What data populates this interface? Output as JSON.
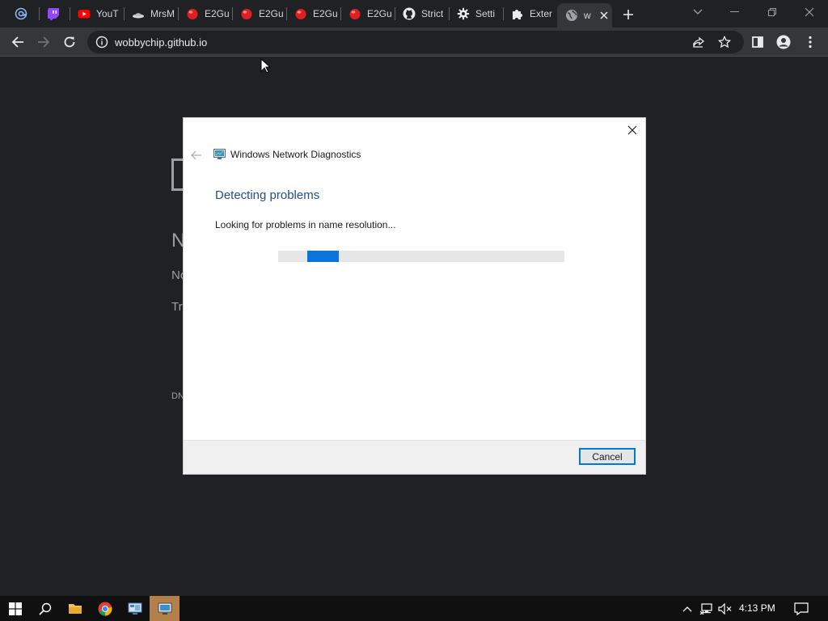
{
  "browser": {
    "tabs": [
      {
        "title": "",
        "icon": "at-sign-icon"
      },
      {
        "title": "",
        "icon": "twitch-icon"
      },
      {
        "title": "YouT",
        "icon": "youtube-icon"
      },
      {
        "title": "MrsM",
        "icon": "hat-icon"
      },
      {
        "title": "E2Gu",
        "icon": "red-ball-icon"
      },
      {
        "title": "E2Gu",
        "icon": "red-ball-icon"
      },
      {
        "title": "E2Gu",
        "icon": "red-ball-icon"
      },
      {
        "title": "E2Gu",
        "icon": "red-ball-icon"
      },
      {
        "title": "Strict",
        "icon": "github-icon"
      },
      {
        "title": "Setti",
        "icon": "gear-icon"
      },
      {
        "title": "Exter",
        "icon": "puzzle-icon"
      },
      {
        "title": "w",
        "icon": "globe-icon",
        "active": true
      }
    ],
    "url": "wobbychip.github.io"
  },
  "background_page": {
    "heading_fragment": "N",
    "line1_fragment": "No",
    "line2_fragment": "Try",
    "code_fragment": "DN"
  },
  "dialog": {
    "title": "Windows Network Diagnostics",
    "heading": "Detecting problems",
    "status": "Looking for problems in name resolution...",
    "progress_state": "indeterminate",
    "cancel_label": "Cancel"
  },
  "taskbar": {
    "clock": "4:13 PM"
  },
  "colors": {
    "accent": "#0a74d8",
    "heading": "#1f4e8c",
    "taskbar_active": "#b3804a"
  }
}
